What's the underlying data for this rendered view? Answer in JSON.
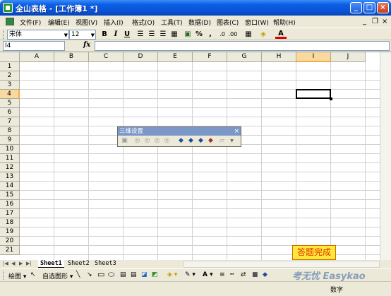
{
  "window": {
    "title": "全山表格 - [工作簿1 *]",
    "minimize": "_",
    "maximize": "□",
    "close": "×"
  },
  "menu": {
    "items": [
      "文件(F)",
      "编辑(E)",
      "视图(V)",
      "插入(I)",
      "格式(O)",
      "工具(T)",
      "数据(D)",
      "图表(C)",
      "窗口(W)",
      "帮助(H)"
    ],
    "mdi_minimize": "_",
    "mdi_restore": "❐",
    "mdi_close": "×"
  },
  "format_toolbar": {
    "font": "宋体",
    "size": "12",
    "bold": "B",
    "italic": "I",
    "underline": "U",
    "percent": "%",
    "comma": ","
  },
  "formula_bar": {
    "cell_ref": "I4",
    "fx": "fx",
    "content": ""
  },
  "grid": {
    "columns": [
      "A",
      "B",
      "C",
      "D",
      "E",
      "F",
      "G",
      "H",
      "I",
      "J"
    ],
    "rows": [
      "1",
      "2",
      "3",
      "4",
      "5",
      "6",
      "7",
      "8",
      "9",
      "10",
      "11",
      "12",
      "13",
      "14",
      "15",
      "16",
      "17",
      "18",
      "19",
      "20",
      "21"
    ],
    "selected_column": "I",
    "selected_row": "4"
  },
  "toolbar_3d": {
    "title": "三维设置",
    "close": "×"
  },
  "sheets": {
    "tabs": [
      "Sheet1",
      "Sheet2",
      "Sheet3"
    ],
    "active": "Sheet1"
  },
  "done_button": "答题完成",
  "draw_toolbar": {
    "draw": "绘图",
    "autoshapes": "自选图形"
  },
  "watermark": "考无忧 Easykao",
  "status": "数字",
  "colors": {
    "title_bar": "#0a5fe3",
    "selected_header": "#f9d99f",
    "done_button_bg": "#ffea3a",
    "done_button_text": "#e03000"
  }
}
